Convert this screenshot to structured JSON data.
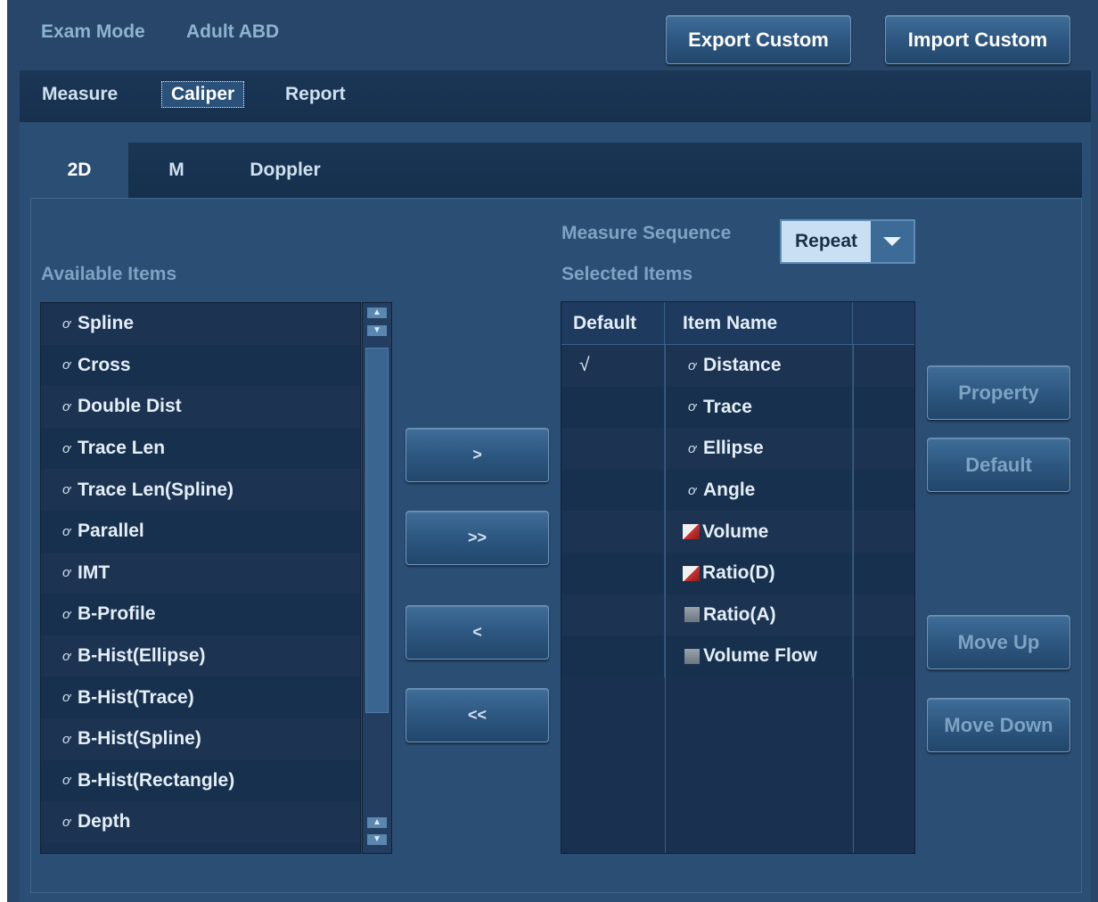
{
  "header": {
    "exam_mode_label": "Exam Mode",
    "exam_mode_value": "Adult ABD",
    "export_button": "Export Custom",
    "import_button": "Import Custom"
  },
  "main_tabs": [
    {
      "label": "Measure"
    },
    {
      "label": "Caliper",
      "active": true
    },
    {
      "label": "Report"
    }
  ],
  "mode_tabs": [
    {
      "label": "2D",
      "active": true
    },
    {
      "label": "M"
    },
    {
      "label": "Doppler"
    }
  ],
  "available": {
    "label": "Available Items",
    "items": [
      {
        "icon": "caliper-icon",
        "label": "Spline"
      },
      {
        "icon": "caliper-icon",
        "label": "Cross"
      },
      {
        "icon": "caliper-icon",
        "label": "Double Dist"
      },
      {
        "icon": "caliper-icon",
        "label": "Trace Len"
      },
      {
        "icon": "caliper-icon",
        "label": "Trace Len(Spline)"
      },
      {
        "icon": "caliper-icon",
        "label": "Parallel"
      },
      {
        "icon": "caliper-icon",
        "label": "IMT"
      },
      {
        "icon": "caliper-icon",
        "label": "B-Profile"
      },
      {
        "icon": "caliper-icon",
        "label": "B-Hist(Ellipse)"
      },
      {
        "icon": "caliper-icon",
        "label": "B-Hist(Trace)"
      },
      {
        "icon": "caliper-icon",
        "label": "B-Hist(Spline)"
      },
      {
        "icon": "caliper-icon",
        "label": "B-Hist(Rectangle)"
      },
      {
        "icon": "caliper-icon",
        "label": "Depth"
      }
    ]
  },
  "transfer_buttons": {
    "add": ">",
    "add_all": ">>",
    "remove": "<",
    "remove_all": "<<"
  },
  "measure_sequence": {
    "label": "Measure Sequence",
    "value": "Repeat"
  },
  "selected": {
    "label": "Selected Items",
    "columns": [
      "Default",
      "Item Name",
      ""
    ],
    "rows": [
      {
        "default": "√",
        "icon": "caliper-icon",
        "name": "Distance"
      },
      {
        "default": "",
        "icon": "caliper-icon",
        "name": "Trace"
      },
      {
        "default": "",
        "icon": "caliper-icon",
        "name": "Ellipse"
      },
      {
        "default": "",
        "icon": "caliper-icon",
        "name": "Angle"
      },
      {
        "default": "",
        "icon": "volume-icon",
        "name": "Volume"
      },
      {
        "default": "",
        "icon": "volume-icon",
        "name": "Ratio(D)"
      },
      {
        "default": "",
        "icon": "gray-square-icon",
        "name": "Ratio(A)"
      },
      {
        "default": "",
        "icon": "gray-square-icon",
        "name": "Volume Flow"
      }
    ]
  },
  "side_buttons": {
    "property": "Property",
    "default": "Default",
    "move_up": "Move Up",
    "move_down": "Move Down"
  },
  "colors": {
    "background": "#27466a",
    "panel": "#2b4e75",
    "list_bg": "#1a3050",
    "label_blue": "#7ea3c3",
    "select_bg": "#c8dff4"
  }
}
